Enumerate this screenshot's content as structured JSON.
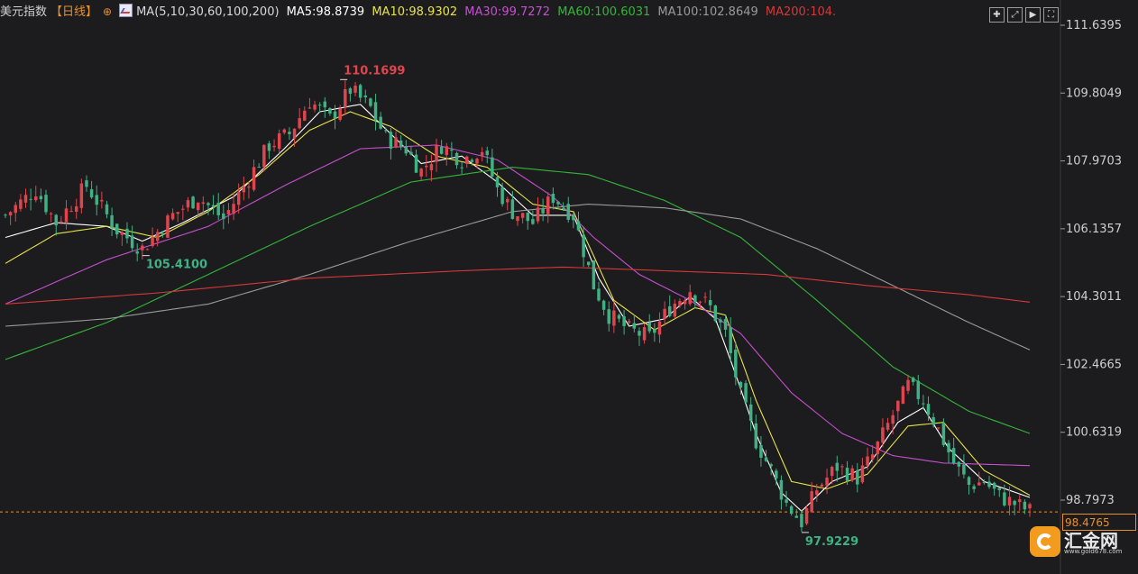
{
  "header": {
    "instrument": "美元指数",
    "period": "【日线】",
    "ma_label": "MA(5,10,30,60,100,200)",
    "ma5": "MA5:98.8739",
    "ma10": "MA10:98.9302",
    "ma30": "MA30:99.7272",
    "ma60": "MA60:100.6031",
    "ma100": "MA100:102.8649",
    "ma200": "MA200:104."
  },
  "colors": {
    "up": "#e0454d",
    "down": "#3fb184",
    "ma5": "#ffffff",
    "ma10": "#e8e34a",
    "ma30": "#c74fd0",
    "ma60": "#34b53a",
    "ma100": "#9a9a9a",
    "ma200": "#d63838",
    "current_price": "#e8912c"
  },
  "toolbar": {
    "icons": [
      "grid-icon",
      "expand-icon",
      "play-icon",
      "fullscreen-icon"
    ]
  },
  "current_price": "98.4765",
  "logo": {
    "name": "汇金网",
    "url": "www.gold678.com"
  },
  "chart_data": {
    "type": "candlestick",
    "y_ticks": [
      "111.6395",
      "109.8049",
      "107.9703",
      "106.1357",
      "104.3011",
      "102.4665",
      "100.6319",
      "98.7973"
    ],
    "ylim": [
      97.6,
      111.9
    ],
    "annotations": [
      {
        "label": "110.1699",
        "value": 110.1699,
        "kind": "high"
      },
      {
        "label": "105.4100",
        "value": 105.41,
        "kind": "low"
      },
      {
        "label": "97.9229",
        "value": 97.9229,
        "kind": "low"
      }
    ],
    "close_path": [
      [
        0,
        106.5
      ],
      [
        6,
        107.2
      ],
      [
        10,
        106.3
      ],
      [
        16,
        107.3
      ],
      [
        22,
        106.1
      ],
      [
        27,
        105.6
      ],
      [
        33,
        106.5
      ],
      [
        38,
        107.0
      ],
      [
        43,
        106.4
      ],
      [
        48,
        107.5
      ],
      [
        52,
        108.4
      ],
      [
        56,
        108.7
      ],
      [
        60,
        109.6
      ],
      [
        64,
        109.1
      ],
      [
        68,
        109.9
      ],
      [
        72,
        109.4
      ],
      [
        75,
        108.6
      ],
      [
        79,
        108.3
      ],
      [
        82,
        107.7
      ],
      [
        86,
        108.4
      ],
      [
        90,
        108.0
      ],
      [
        94,
        108.3
      ],
      [
        97,
        107.2
      ],
      [
        100,
        106.6
      ],
      [
        104,
        106.3
      ],
      [
        108,
        107.0
      ],
      [
        112,
        106.5
      ],
      [
        116,
        104.6
      ],
      [
        119,
        103.8
      ],
      [
        123,
        103.4
      ],
      [
        127,
        103.2
      ],
      [
        131,
        104.0
      ],
      [
        135,
        104.5
      ],
      [
        139,
        104.0
      ],
      [
        142,
        103.3
      ],
      [
        145,
        101.6
      ],
      [
        148,
        100.4
      ],
      [
        151,
        99.6
      ],
      [
        154,
        98.7
      ],
      [
        157,
        98.2
      ],
      [
        160,
        99.1
      ],
      [
        164,
        99.7
      ],
      [
        168,
        99.4
      ],
      [
        171,
        100.0
      ],
      [
        175,
        101.1
      ],
      [
        178,
        101.9
      ],
      [
        181,
        101.5
      ],
      [
        184,
        100.7
      ],
      [
        187,
        99.8
      ],
      [
        190,
        99.2
      ],
      [
        193,
        99.3
      ],
      [
        196,
        98.9
      ],
      [
        199,
        98.7
      ],
      [
        202,
        98.5
      ]
    ],
    "ma_series": [
      {
        "name": "MA5",
        "values": [
          [
            0,
            105.9
          ],
          [
            10,
            106.3
          ],
          [
            20,
            106.2
          ],
          [
            27,
            105.8
          ],
          [
            35,
            106.3
          ],
          [
            45,
            107.0
          ],
          [
            55,
            108.3
          ],
          [
            62,
            109.3
          ],
          [
            70,
            109.5
          ],
          [
            76,
            108.7
          ],
          [
            82,
            107.9
          ],
          [
            90,
            108.1
          ],
          [
            97,
            107.4
          ],
          [
            104,
            106.5
          ],
          [
            112,
            106.5
          ],
          [
            117,
            104.8
          ],
          [
            123,
            103.5
          ],
          [
            130,
            103.7
          ],
          [
            135,
            104.3
          ],
          [
            140,
            103.7
          ],
          [
            144,
            102.2
          ],
          [
            148,
            100.6
          ],
          [
            153,
            99.0
          ],
          [
            157,
            98.5
          ],
          [
            163,
            99.3
          ],
          [
            170,
            99.7
          ],
          [
            176,
            100.9
          ],
          [
            181,
            101.3
          ],
          [
            186,
            100.2
          ],
          [
            193,
            99.3
          ],
          [
            202,
            98.87
          ]
        ]
      },
      {
        "name": "MA10",
        "values": [
          [
            0,
            105.2
          ],
          [
            10,
            106.0
          ],
          [
            20,
            106.2
          ],
          [
            30,
            105.9
          ],
          [
            40,
            106.6
          ],
          [
            50,
            107.6
          ],
          [
            60,
            108.8
          ],
          [
            68,
            109.3
          ],
          [
            76,
            108.9
          ],
          [
            85,
            108.1
          ],
          [
            95,
            107.8
          ],
          [
            104,
            106.8
          ],
          [
            112,
            106.6
          ],
          [
            120,
            104.2
          ],
          [
            128,
            103.4
          ],
          [
            136,
            104.0
          ],
          [
            142,
            103.8
          ],
          [
            148,
            101.5
          ],
          [
            155,
            99.3
          ],
          [
            162,
            99.1
          ],
          [
            170,
            99.5
          ],
          [
            178,
            100.8
          ],
          [
            185,
            100.9
          ],
          [
            193,
            99.6
          ],
          [
            202,
            98.93
          ]
        ]
      },
      {
        "name": "MA30",
        "values": [
          [
            0,
            104.1
          ],
          [
            20,
            105.3
          ],
          [
            40,
            106.2
          ],
          [
            55,
            107.3
          ],
          [
            70,
            108.3
          ],
          [
            85,
            108.4
          ],
          [
            97,
            108.0
          ],
          [
            108,
            107.0
          ],
          [
            116,
            105.9
          ],
          [
            125,
            104.9
          ],
          [
            135,
            104.2
          ],
          [
            145,
            103.3
          ],
          [
            155,
            101.7
          ],
          [
            165,
            100.6
          ],
          [
            175,
            100.0
          ],
          [
            185,
            99.8
          ],
          [
            202,
            99.73
          ]
        ]
      },
      {
        "name": "MA60",
        "values": [
          [
            0,
            102.6
          ],
          [
            20,
            103.6
          ],
          [
            40,
            104.9
          ],
          [
            60,
            106.2
          ],
          [
            80,
            107.4
          ],
          [
            100,
            107.8
          ],
          [
            115,
            107.6
          ],
          [
            130,
            106.9
          ],
          [
            145,
            105.9
          ],
          [
            160,
            104.2
          ],
          [
            175,
            102.4
          ],
          [
            190,
            101.2
          ],
          [
            202,
            100.6
          ]
        ]
      },
      {
        "name": "MA100",
        "values": [
          [
            0,
            103.5
          ],
          [
            20,
            103.7
          ],
          [
            40,
            104.1
          ],
          [
            60,
            104.9
          ],
          [
            80,
            105.8
          ],
          [
            100,
            106.6
          ],
          [
            115,
            106.8
          ],
          [
            130,
            106.7
          ],
          [
            145,
            106.4
          ],
          [
            160,
            105.6
          ],
          [
            175,
            104.6
          ],
          [
            190,
            103.6
          ],
          [
            202,
            102.86
          ]
        ]
      },
      {
        "name": "MA200",
        "values": [
          [
            0,
            104.1
          ],
          [
            30,
            104.4
          ],
          [
            60,
            104.8
          ],
          [
            90,
            105.0
          ],
          [
            110,
            105.1
          ],
          [
            130,
            105.0
          ],
          [
            150,
            104.9
          ],
          [
            170,
            104.6
          ],
          [
            190,
            104.35
          ],
          [
            202,
            104.15
          ]
        ]
      }
    ]
  }
}
